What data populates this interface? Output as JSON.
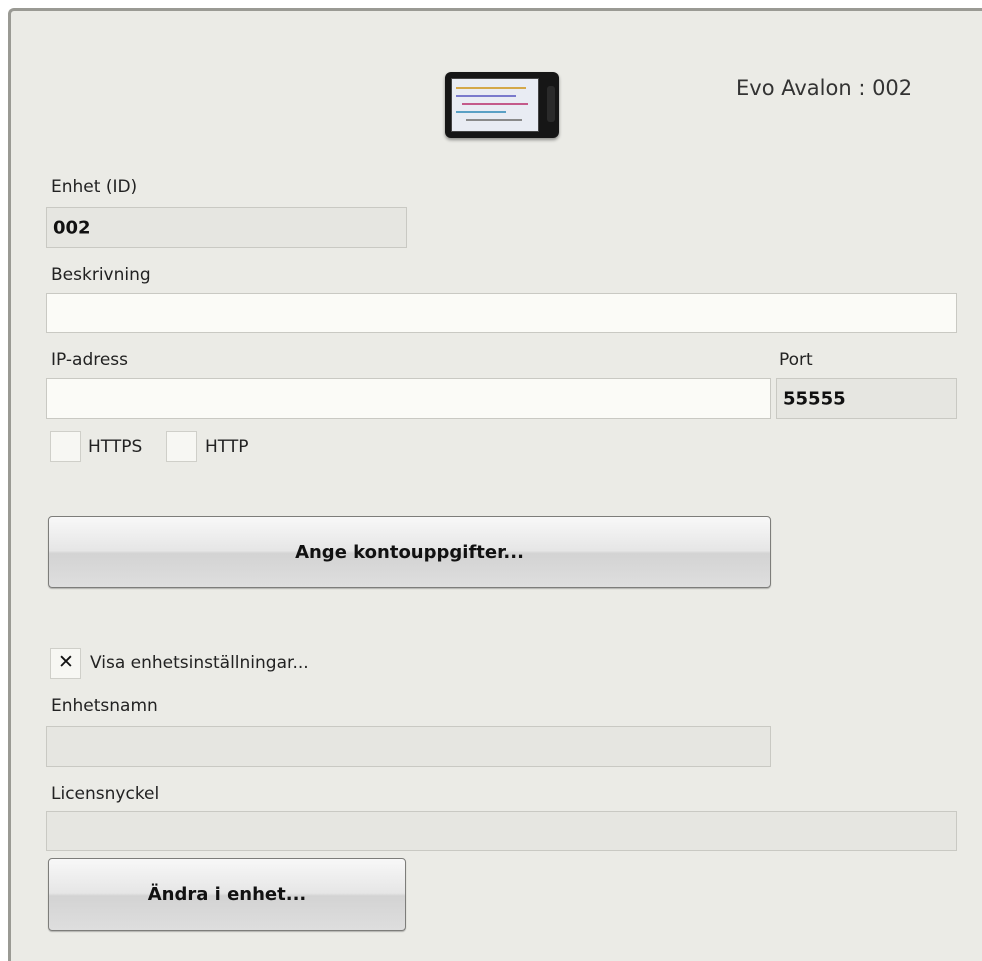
{
  "header": {
    "device_title": "Evo Avalon : 002",
    "device_image_icon": "handheld-device-icon"
  },
  "form": {
    "unit_id": {
      "label": "Enhet (ID)",
      "value": "002"
    },
    "description": {
      "label": "Beskrivning",
      "value": ""
    },
    "ip_address": {
      "label": "IP-adress",
      "value": ""
    },
    "port": {
      "label": "Port",
      "value": "55555"
    },
    "protocols": [
      {
        "label": "HTTPS",
        "checked": false
      },
      {
        "label": "HTTP",
        "checked": false
      }
    ],
    "account_button_label": "Ange kontouppgifter...",
    "show_settings": {
      "label": "Visa enhetsinställningar...",
      "checked": true
    },
    "device_name": {
      "label": "Enhetsnamn",
      "value": ""
    },
    "license_key": {
      "label": "Licensnyckel",
      "value": ""
    },
    "change_button_label": "Ändra i enhet..."
  },
  "colors": {
    "panel_bg": "#ebebe6",
    "field_bg": "#fbfbf7",
    "readonly_bg": "#e6e6e1"
  }
}
